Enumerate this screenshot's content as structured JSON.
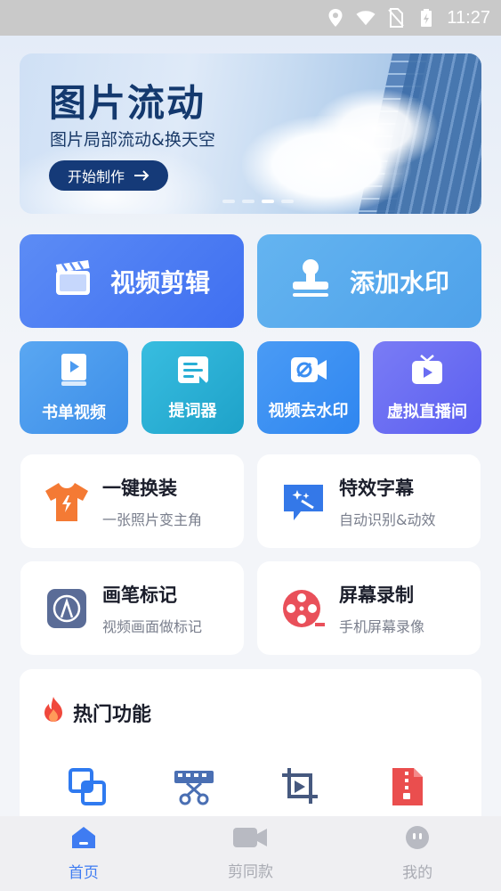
{
  "status_bar": {
    "time": "11:27"
  },
  "banner": {
    "title": "图片流动",
    "subtitle": "图片局部流动&换天空",
    "button": "开始制作",
    "dots": 4,
    "active_dot": 2
  },
  "main_actions": [
    {
      "label": "视频剪辑",
      "icon": "clapperboard-icon"
    },
    {
      "label": "添加水印",
      "icon": "stamp-icon"
    }
  ],
  "quick_actions": [
    {
      "label": "书单视频",
      "icon": "book-video-icon"
    },
    {
      "label": "提词器",
      "icon": "teleprompter-icon"
    },
    {
      "label": "视频去水印",
      "icon": "remove-watermark-icon"
    },
    {
      "label": "虚拟直播间",
      "icon": "tv-icon"
    }
  ],
  "features": [
    {
      "title": "一键换装",
      "subtitle": "一张照片变主角",
      "icon": "tshirt-icon"
    },
    {
      "title": "特效字幕",
      "subtitle": "自动识别&动效",
      "icon": "magic-subtitle-icon"
    },
    {
      "title": "画笔标记",
      "subtitle": "视频画面做标记",
      "icon": "brush-icon"
    },
    {
      "title": "屏幕录制",
      "subtitle": "手机屏幕录像",
      "icon": "film-reel-icon"
    }
  ],
  "hot": {
    "title": "热门功能",
    "icons": [
      "overlay-icon",
      "video-cut-icon",
      "crop-icon",
      "zip-file-icon"
    ]
  },
  "nav": {
    "items": [
      {
        "label": "首页",
        "icon": "home-icon",
        "active": true
      },
      {
        "label": "剪同款",
        "icon": "camera-icon",
        "active": false
      },
      {
        "label": "我的",
        "icon": "profile-icon",
        "active": false
      }
    ]
  },
  "colors": {
    "accent": "#3f7cf2",
    "banner_button": "#153a78"
  }
}
